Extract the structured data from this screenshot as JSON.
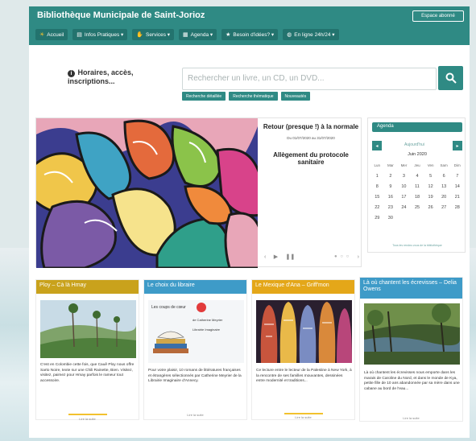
{
  "header": {
    "title": "Bibliothèque Municipale de Saint-Jorioz",
    "account_label": "Espace abonné",
    "nav": [
      {
        "icon": "sun-icon",
        "label": "Accueil"
      },
      {
        "icon": "book-icon",
        "label": "Infos Pratiques ▾"
      },
      {
        "icon": "hands-icon",
        "label": "Services ▾"
      },
      {
        "icon": "calendar-icon",
        "label": "Agenda ▾"
      },
      {
        "icon": "star-icon",
        "label": "Besoin d'idées? ▾"
      },
      {
        "icon": "globe-icon",
        "label": "En ligne 24h/24 ▾"
      }
    ]
  },
  "info": {
    "label": "Horaires, accès, inscriptions..."
  },
  "search": {
    "placeholder": "Rechercher un livre, un CD, un DVD...",
    "buttons": [
      "Recherche détaillée",
      "Recherche thématique",
      "Nouveautés"
    ]
  },
  "carousel": {
    "title": "Retour (presque !) à la normale",
    "date": "Du 01/07/2020 au 31/07/2020",
    "subtitle": "Allègement du protocole sanitaire",
    "prev_label": "‹",
    "next_label": "›",
    "play_label": "▶",
    "pause_label": "❚❚",
    "dots": "● ○ ○"
  },
  "agenda": {
    "header": "Agenda",
    "prev": "◂",
    "next": "▸",
    "today": "Aujourd'hui",
    "month": "Juin 2020",
    "weekdays": [
      "Lun",
      "Mar",
      "Mer",
      "Jeu",
      "Ven",
      "Sam",
      "Dim"
    ],
    "weeks": [
      [
        "1",
        "2",
        "3",
        "4",
        "5",
        "6",
        "7"
      ],
      [
        "8",
        "9",
        "10",
        "11",
        "12",
        "13",
        "14"
      ],
      [
        "15",
        "16",
        "17",
        "18",
        "19",
        "20",
        "21"
      ],
      [
        "22",
        "23",
        "24",
        "25",
        "26",
        "27",
        "28"
      ],
      [
        "29",
        "30",
        "",
        "",
        "",
        "",
        ""
      ]
    ],
    "footer": "Tous les rendez-vous de la bibliothèque"
  },
  "cards": [
    {
      "title": "Ploy – Cà là Hmay",
      "color": "#c9a21c",
      "body": "C'est en Colombie cette fois, que Cauê Ploy nous offre Sarto Noire, texte sur une Chili Rainette, Bien. Visitez, visitez, paimez pour Hmay parfois le rameur tout accessoire.",
      "link": "Lire la suite"
    },
    {
      "title": "Le choix du libraire",
      "color": "#3e9bc8",
      "banner": "Les coups de cœur",
      "banner_sub": "de Catherine Meyrier",
      "banner_sub2": "Librairie Imaginaire",
      "body": "Pour votre plaisir, 10 romans de littératures françaises et étrangères sélectionnés par Catherine Meyrier de la Librairie Imaginaire d'Annecy.",
      "link": "Lire la suite"
    },
    {
      "title": "Le Mexique d'Ana – Griff'mon",
      "color": "#e4a719",
      "body": "Ce lecture entre le lecteur de la Palestine à New York, à la rencontre de ses familles mouvantes, dessinées entre modernité et traditions...",
      "link": "Lire la suite"
    },
    {
      "title": "Là où chantent les écrevisses – Delia Owens",
      "color": "#3e9bc8",
      "body": "Là où chantent les écrevisses nous emporte dans les marais de Caroline du Nord, et dans le monde de Kya, petite fille de 10 ans abandonnée par sa mère dans une cabane au bord de l'eau...",
      "link": "Lire la suite"
    }
  ]
}
